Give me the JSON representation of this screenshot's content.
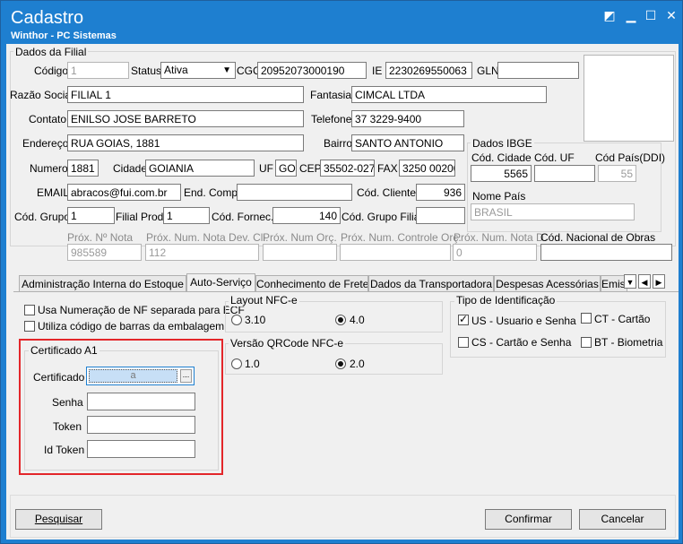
{
  "window": {
    "title": "Cadastro",
    "subtitle": "Winthor - PC Sistemas"
  },
  "dados_filial": {
    "group_label": "Dados da Filial",
    "codigo_label": "Código",
    "codigo_value": "1",
    "status_label": "Status",
    "status_value": "Ativa",
    "cgc_label": "CGC",
    "cgc_value": "20952073000190",
    "ie_label": "IE",
    "ie_value": "2230269550063",
    "gln_label": "GLN",
    "gln_value": "",
    "razao_label": "Razão Social",
    "razao_value": "FILIAL 1",
    "fantasia_label": "Fantasia",
    "fantasia_value": "CIMCAL LTDA",
    "contato_label": "Contato",
    "contato_value": "ENILSO JOSE BARRETO",
    "telefone_label": "Telefone",
    "telefone_value": "37 3229-9400",
    "endereco_label": "Endereço",
    "endereco_value": "RUA GOIAS, 1881",
    "bairro_label": "Bairro",
    "bairro_value": "SANTO ANTONIO",
    "numero_label": "Numero",
    "numero_value": "1881",
    "cidade_label": "Cidade",
    "cidade_value": "GOIANIA",
    "uf_label": "UF",
    "uf_value": "GO",
    "cep_label": "CEP",
    "cep_value": "35502-027",
    "fax_label": "FAX",
    "fax_value": "3250 00200",
    "email_label": "EMAIL",
    "email_value": "abracos@fui.com.br",
    "endcomp_label": "End. Comp.",
    "endcomp_value": "",
    "codcliente_label": "Cód. Cliente",
    "codcliente_value": "936",
    "codgrupo_label": "Cód. Grupo",
    "codgrupo_value": "1",
    "filialprod_label": "Filial Prod.",
    "filialprod_value": "1",
    "codfornec_label": "Cód. Fornec.",
    "codfornec_value": "140",
    "codgrupofilial_label": "Cód. Grupo Filial",
    "codgrupofilial_value": "",
    "proxnota_label": "Próx. Nº Nota",
    "proxnota_value": "985589",
    "proxnotadev_label": "Próx. Num. Nota Dev. Cli.",
    "proxnotadev_value": "112",
    "proxorc_label": "Próx. Num Orç.",
    "proxorc_value": "",
    "proxcontrole_label": "Próx. Num. Controle Orç.",
    "proxcontrole_value": "",
    "proxnotad_label": "Próx. Num. Nota D.",
    "proxnotad_value": "0",
    "codnacobras_label": "Cód. Nacional de Obras",
    "codnacobras_value": ""
  },
  "dados_ibge": {
    "group_label": "Dados IBGE",
    "codcidade_label": "Cód. Cidade",
    "codcidade_value": "5565",
    "coduf_label": "Cód. UF",
    "coduf_value": "",
    "codpais_label": "Cód País(DDI)",
    "codpais_value": "55",
    "nomepais_label": "Nome País",
    "nomepais_value": "BRASIL"
  },
  "tabs": [
    "Administração Interna do Estoque",
    "Auto-Serviço",
    "Conhecimento de Frete",
    "Dados da Transportadora",
    "Despesas Acessórias",
    "Emiss"
  ],
  "auto_servico": {
    "cb_usa_numeracao": "Usa Numeração de NF separada para ECF",
    "cb_utiliza_codigo": "Utiliza código de barras da embalagem",
    "layout_label": "Layout NFC-e",
    "layout_opt1": "3.10",
    "layout_opt2": "4.0",
    "versao_label": "Versão QRCode NFC-e",
    "versao_opt1": "1.0",
    "versao_opt2": "2.0",
    "tipo_label": "Tipo de Identificação",
    "tipo_us": "US - Usuario e Senha",
    "tipo_ct": "CT - Cartão",
    "tipo_cs": "CS - Cartão e Senha",
    "tipo_bt": "BT - Biometria",
    "cert_group_label": "Certificado A1",
    "cert_label": "Certificado",
    "cert_value": "a",
    "cert_browse": "...",
    "senha_label": "Senha",
    "token_label": "Token",
    "idtoken_label": "Id Token"
  },
  "buttons": {
    "pesquisar": "Pesquisar",
    "confirmar": "Confirmar",
    "cancelar": "Cancelar"
  },
  "colors": {
    "titlebar": "#1e7fd0",
    "highlight": "#e3262a"
  }
}
